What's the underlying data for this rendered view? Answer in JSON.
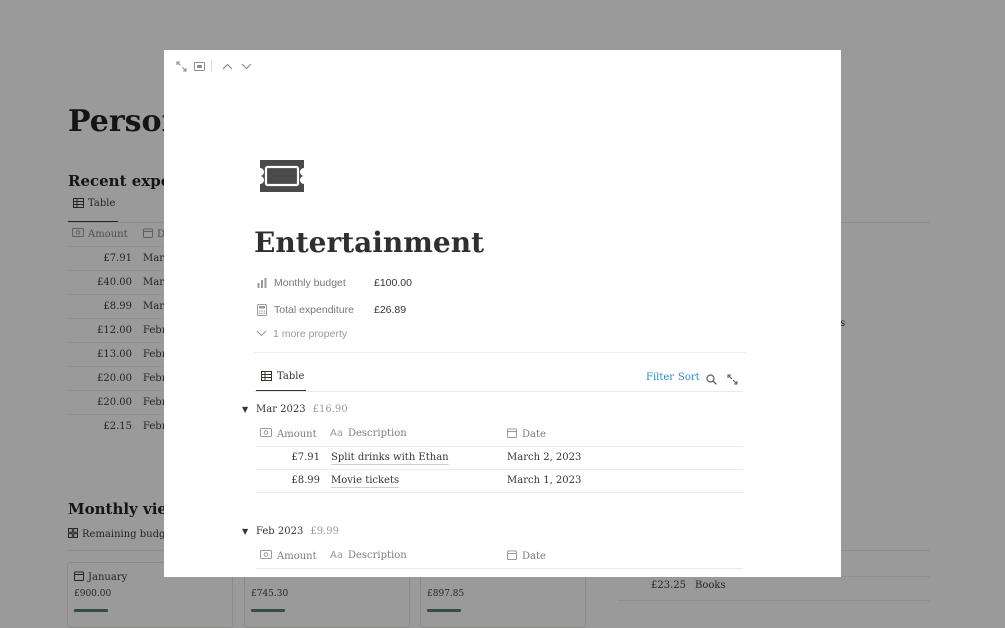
{
  "background": {
    "page_title": "Persona",
    "recent_heading": "Recent expens",
    "recent_tab": "Table",
    "columns": {
      "amount": "Amount",
      "date_partial": "D"
    },
    "rows": [
      {
        "amount": "£7.91",
        "date": "Marc"
      },
      {
        "amount": "£40.00",
        "date": "Marc"
      },
      {
        "amount": "£8.99",
        "date": "Marc"
      },
      {
        "amount": "£12.00",
        "date": "Febru"
      },
      {
        "amount": "£13.00",
        "date": "Febru"
      },
      {
        "amount": "£20.00",
        "date": "Febru"
      },
      {
        "amount": "£20.00",
        "date": "Febru"
      },
      {
        "amount": "£2.15",
        "date": "Febru"
      }
    ],
    "right_partial": "s",
    "monthly_heading": "Monthly views",
    "monthly_tab": "Remaining budge",
    "cards": [
      {
        "name": "January",
        "value": "£900.00",
        "progress": 0.9
      },
      {
        "name": "",
        "value": "£745.30",
        "progress": 0.75
      },
      {
        "name": "",
        "value": "£897.85",
        "progress": 0.9
      }
    ],
    "right_row": {
      "amount": "£23.25",
      "label": "Books"
    }
  },
  "modal": {
    "title": "Entertainment",
    "icon": "ticket-icon",
    "properties": [
      {
        "name": "Monthly budget",
        "value": "£100.00",
        "icon": "bar-chart-icon"
      },
      {
        "name": "Total expenditure",
        "value": "£26.89",
        "icon": "calculator-icon"
      }
    ],
    "more_properties": "1 more property",
    "view": {
      "tab": "Table",
      "filter": "Filter",
      "sort": "Sort"
    },
    "columns": {
      "amount": "Amount",
      "description": "Description",
      "date": "Date"
    },
    "groups": [
      {
        "name": "Mar 2023",
        "sum": "£16.90",
        "rows": [
          {
            "amount": "£7.91",
            "description": "Split drinks with Ethan",
            "date": "March 2, 2023"
          },
          {
            "amount": "£8.99",
            "description": "Movie tickets",
            "date": "March 1, 2023"
          }
        ]
      },
      {
        "name": "Feb 2023",
        "sum": "£9.99",
        "rows": []
      }
    ]
  }
}
